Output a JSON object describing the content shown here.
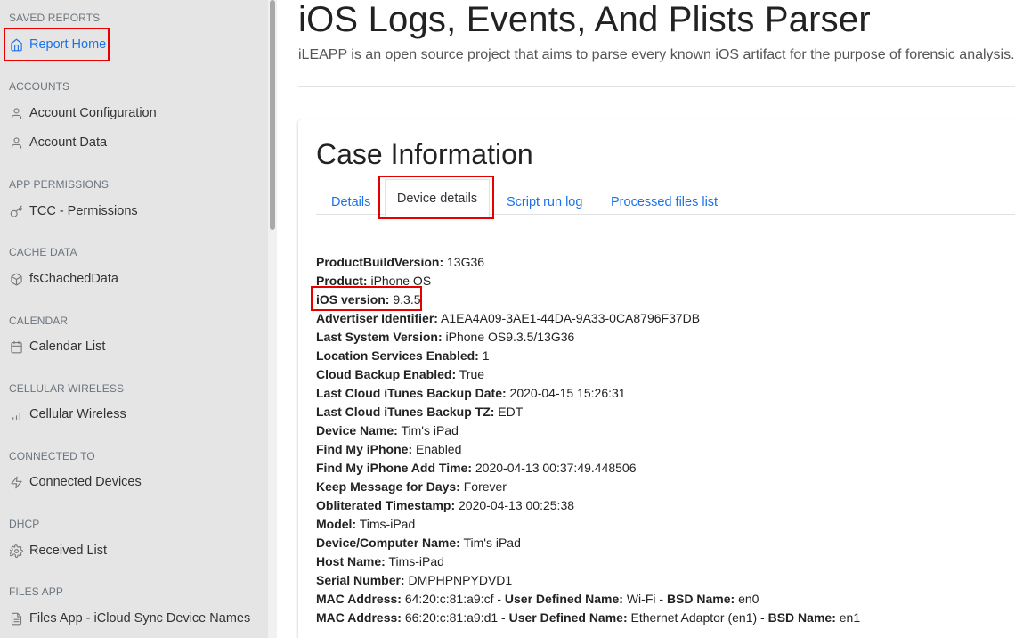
{
  "sidebar": {
    "sections": [
      {
        "heading": "SAVED REPORTS",
        "items": [
          {
            "label": "Report Home",
            "icon": "home-icon"
          }
        ]
      },
      {
        "heading": "ACCOUNTS",
        "items": [
          {
            "label": "Account Configuration",
            "icon": "user-icon"
          },
          {
            "label": "Account Data",
            "icon": "user-icon"
          }
        ]
      },
      {
        "heading": "APP PERMISSIONS",
        "items": [
          {
            "label": "TCC - Permissions",
            "icon": "key-icon"
          }
        ]
      },
      {
        "heading": "CACHE DATA",
        "items": [
          {
            "label": "fsChachedData",
            "icon": "box-icon"
          }
        ]
      },
      {
        "heading": "CALENDAR",
        "items": [
          {
            "label": "Calendar List",
            "icon": "calendar-icon"
          }
        ]
      },
      {
        "heading": "CELLULAR WIRELESS",
        "items": [
          {
            "label": "Cellular Wireless",
            "icon": "bar-chart-icon"
          }
        ]
      },
      {
        "heading": "CONNECTED TO",
        "items": [
          {
            "label": "Connected Devices",
            "icon": "zap-icon"
          }
        ]
      },
      {
        "heading": "DHCP",
        "items": [
          {
            "label": "Received List",
            "icon": "settings-icon"
          }
        ]
      },
      {
        "heading": "FILES APP",
        "items": [
          {
            "label": "Files App - iCloud Sync Device Names",
            "icon": "file-text-icon"
          }
        ]
      }
    ],
    "active_item": "Report Home",
    "active_color": "#1a73e8"
  },
  "header": {
    "title": "iOS Logs, Events, And Plists Parser",
    "subtitle": "iLEAPP is an open source project that aims to parse every known iOS artifact for the purpose of forensic analysis."
  },
  "case": {
    "title": "Case Information",
    "tabs": [
      {
        "label": "Details",
        "active": false
      },
      {
        "label": "Device details",
        "active": true
      },
      {
        "label": "Script run log",
        "active": false
      },
      {
        "label": "Processed files list",
        "active": false
      }
    ],
    "device_details": {
      "build": {
        "key": "ProductBuildVersion:",
        "value": " 13G36"
      },
      "product": {
        "key": "Product:",
        "value": " iPhone OS"
      },
      "ios_version": {
        "key": "iOS version:",
        "value": " 9.3.5"
      },
      "advertiser": {
        "key": "Advertiser Identifier:",
        "value": " A1EA4A09-3AE1-44DA-9A33-0CA8796F37DB"
      },
      "last_system": {
        "key": "Last System Version:",
        "value": " iPhone OS9.3.5/13G36"
      },
      "location": {
        "key": "Location Services Enabled:",
        "value": " 1"
      },
      "cloud_backup": {
        "key": "Cloud Backup Enabled:",
        "value": " True"
      },
      "backup_date": {
        "key": "Last Cloud iTunes Backup Date:",
        "value": " 2020-04-15 15:26:31"
      },
      "backup_tz": {
        "key": "Last Cloud iTunes Backup TZ:",
        "value": " EDT"
      },
      "device_name": {
        "key": "Device Name:",
        "value": " Tim's iPad"
      },
      "find_my": {
        "key": "Find My iPhone:",
        "value": " Enabled"
      },
      "find_my_time": {
        "key": "Find My iPhone Add Time:",
        "value": " 2020-04-13 00:37:49.448506"
      },
      "keep_msg": {
        "key": "Keep Message for Days:",
        "value": " Forever"
      },
      "obliterated": {
        "key": "Obliterated Timestamp:",
        "value": " 2020-04-13 00:25:38"
      },
      "model": {
        "key": "Model:",
        "value": " Tims-iPad"
      },
      "computer_name": {
        "key": "Device/Computer Name:",
        "value": " Tim's iPad"
      },
      "host_name": {
        "key": "Host Name:",
        "value": " Tims-iPad"
      },
      "serial": {
        "key": "Serial Number:",
        "value": " DMPHPNPYDVD1"
      },
      "mac1": {
        "mac_key": "MAC Address:",
        "mac_value": " 64:20:c:81:a9:cf - ",
        "udn_key": "User Defined Name:",
        "udn_value": " Wi-Fi - ",
        "bsd_key": "BSD Name:",
        "bsd_value": " en0"
      },
      "mac2": {
        "mac_key": "MAC Address:",
        "mac_value": " 66:20:c:81:a9:d1 - ",
        "udn_key": "User Defined Name:",
        "udn_value": " Ethernet Adaptor (en1) - ",
        "bsd_key": "BSD Name:",
        "bsd_value": " en1"
      }
    }
  },
  "highlight_color": "#e60000"
}
